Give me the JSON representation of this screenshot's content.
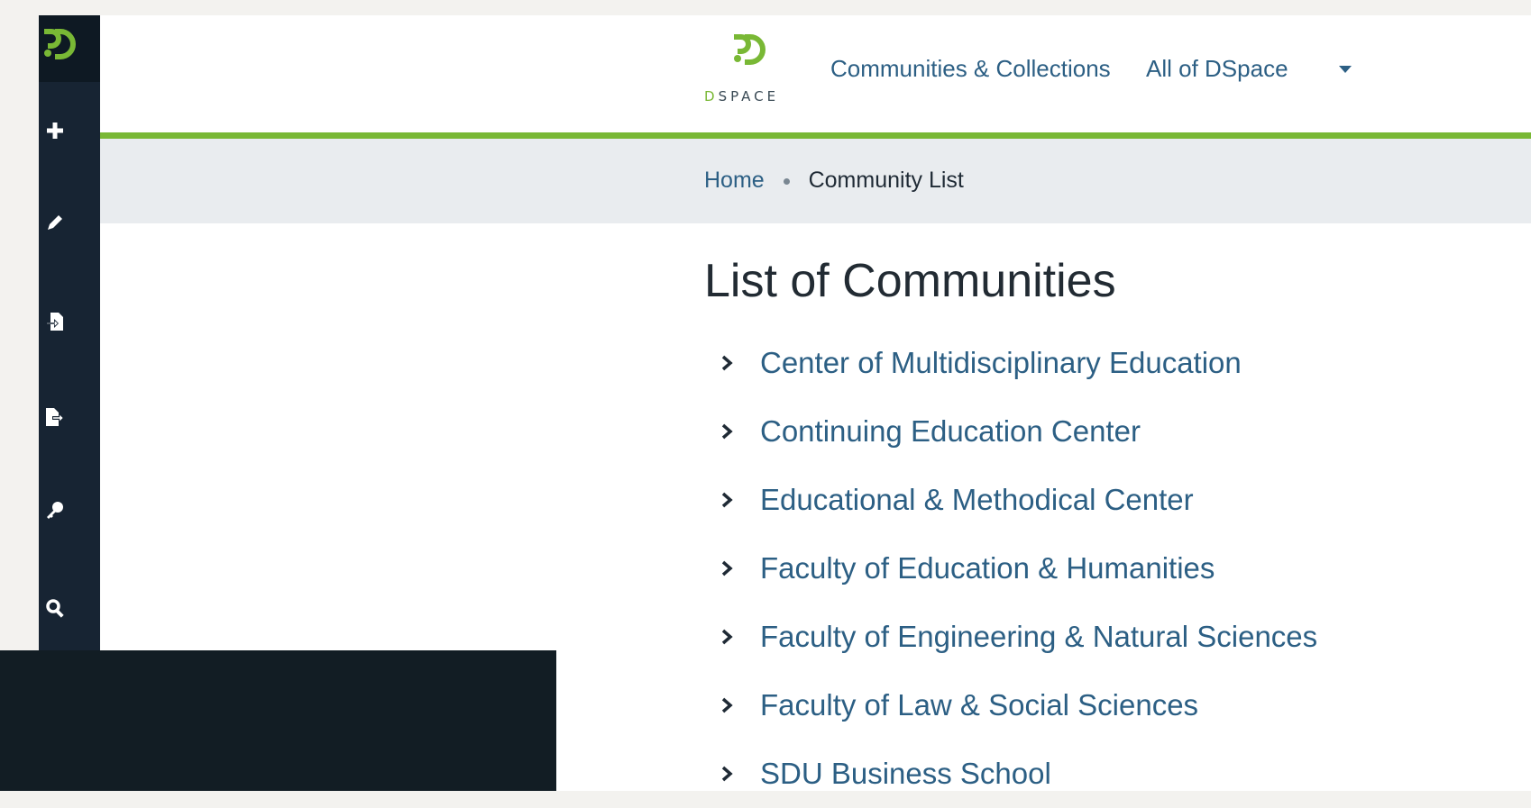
{
  "header": {
    "logo_text": "DSPACE",
    "nav": {
      "communities_label": "Communities & Collections",
      "all_dspace_label": "All of DSpace"
    }
  },
  "breadcrumb": {
    "home": "Home",
    "current": "Community List"
  },
  "page": {
    "title": "List of Communities",
    "communities": [
      {
        "label": "Center of Multidisciplinary Education"
      },
      {
        "label": "Continuing Education Center"
      },
      {
        "label": "Educational & Methodical Center"
      },
      {
        "label": "Faculty of Education & Humanities"
      },
      {
        "label": "Faculty of Engineering & Natural Sciences"
      },
      {
        "label": "Faculty of Law & Social Sciences"
      },
      {
        "label": "SDU Business School"
      }
    ]
  },
  "admin_sidebar": {
    "icons": [
      "dspace-logo-icon",
      "plus-icon",
      "pencil-icon",
      "import-icon",
      "export-icon",
      "key-icon",
      "search-icon"
    ]
  },
  "colors": {
    "accent_green": "#79b835",
    "link_blue": "#2c5f84",
    "sidebar_dark": "#172433"
  }
}
